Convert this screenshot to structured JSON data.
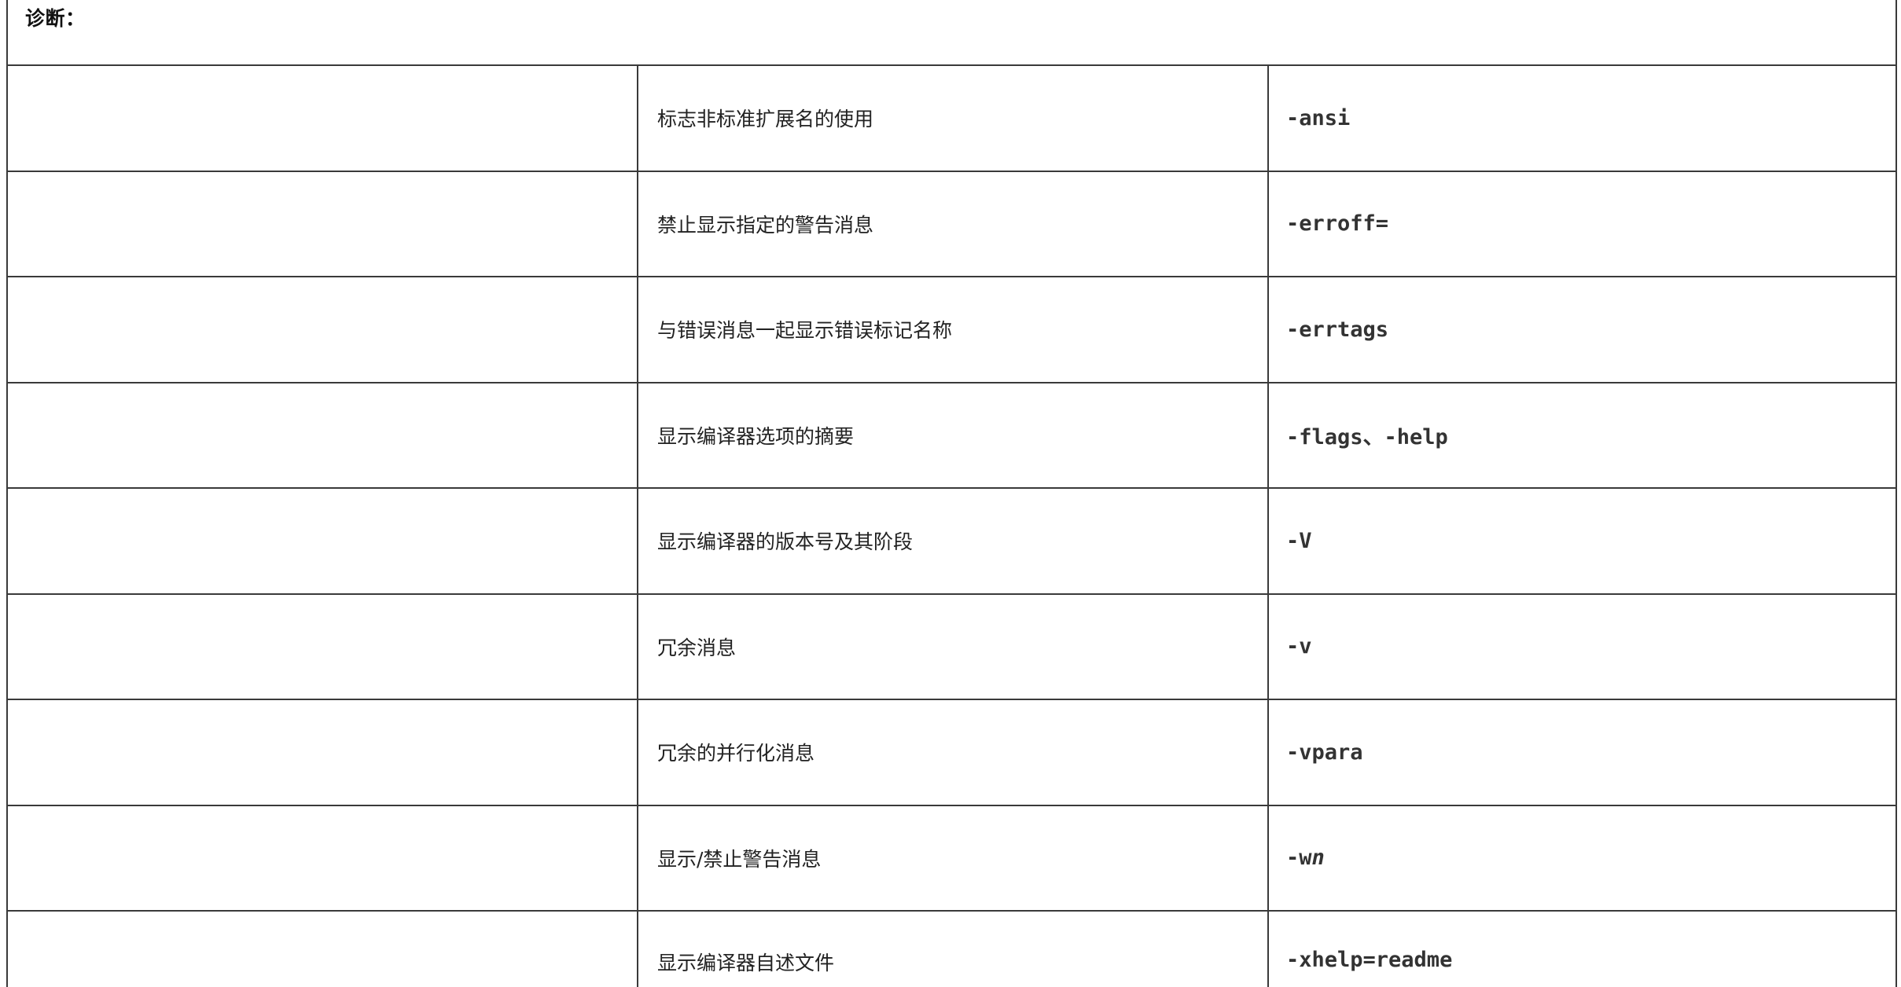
{
  "header": {
    "title": "诊断："
  },
  "rows": [
    {
      "description": "标志非标准扩展名的使用",
      "option": "-ansi"
    },
    {
      "description": "禁止显示指定的警告消息",
      "option": "-erroff="
    },
    {
      "description": "与错误消息一起显示错误标记名称",
      "option": "-errtags"
    },
    {
      "description": "显示编译器选项的摘要",
      "option": "-flags、-help"
    },
    {
      "description": "显示编译器的版本号及其阶段",
      "option": "-V"
    },
    {
      "description": "冗余消息",
      "option": "-v"
    },
    {
      "description": "冗余的并行化消息",
      "option": "-vpara"
    },
    {
      "description": "显示/禁止警告消息",
      "option_prefix": "-w",
      "option_suffix": "n"
    },
    {
      "description": "显示编译器自述文件",
      "option": "-xhelp=readme"
    }
  ]
}
